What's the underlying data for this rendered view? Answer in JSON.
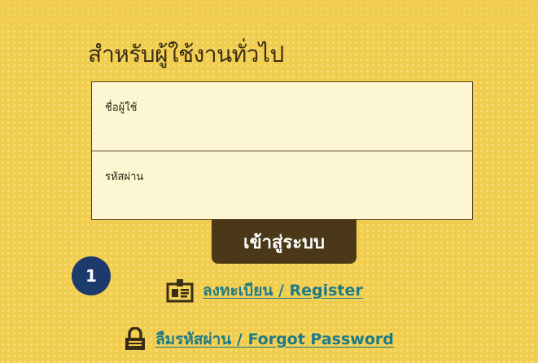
{
  "section": {
    "title": "สำหรับผู้ใช้งานทั่วไป"
  },
  "form": {
    "username": {
      "label": "ชื่อผู้ใช้",
      "value": ""
    },
    "password": {
      "label": "รหัสผ่าน",
      "value": ""
    },
    "login_label": "เข้าสู่ระบบ"
  },
  "step_badge": "1",
  "links": {
    "register": {
      "label": "ลงทะเบียน / Register",
      "icon": "id-card-icon"
    },
    "forgot": {
      "label": "ลืมรหัสผ่าน / Forgot Password",
      "icon": "lock-icon"
    }
  },
  "colors": {
    "background": "#f0cd4f",
    "button": "#4a3818",
    "link": "#1f7a87",
    "badge": "#1c3a6b",
    "field": "#fcf6d2"
  }
}
